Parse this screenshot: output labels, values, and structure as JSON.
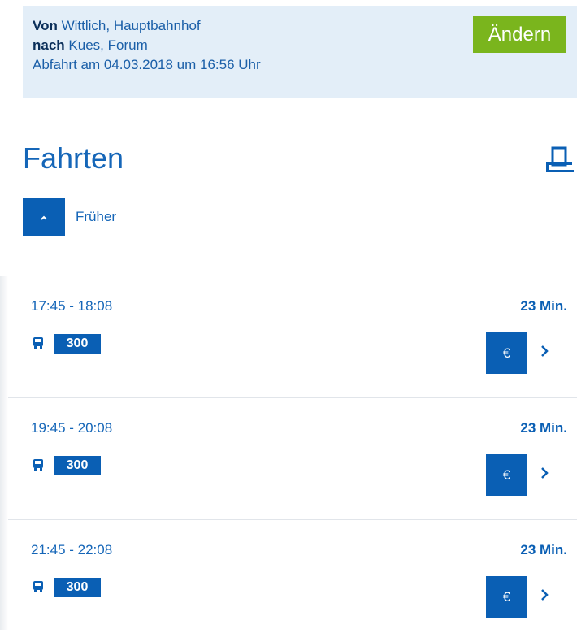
{
  "summary": {
    "from_label": "Von",
    "from_value": "Wittlich, Hauptbahnhof",
    "to_label": "nach",
    "to_value": "Kues, Forum",
    "departure": "Abfahrt am 04.03.2018 um 16:56 Uhr",
    "change_button": "Ändern"
  },
  "results": {
    "title": "Fahrten",
    "earlier_label": "Früher"
  },
  "trips": [
    {
      "time": "17:45 - 18:08",
      "duration": "23 Min.",
      "line": "300",
      "fare_symbol": "€"
    },
    {
      "time": "19:45 - 20:08",
      "duration": "23 Min.",
      "line": "300",
      "fare_symbol": "€"
    },
    {
      "time": "21:45 - 22:08",
      "duration": "23 Min.",
      "line": "300",
      "fare_symbol": "€"
    }
  ],
  "icons": {
    "print": "printer-icon",
    "earlier": "chevron-up-icon",
    "bus": "bus-icon",
    "details": "chevron-right-icon"
  },
  "colors": {
    "primary": "#0a5fb4",
    "accent_green": "#7ab51d",
    "summary_bg": "#e3eef8"
  }
}
